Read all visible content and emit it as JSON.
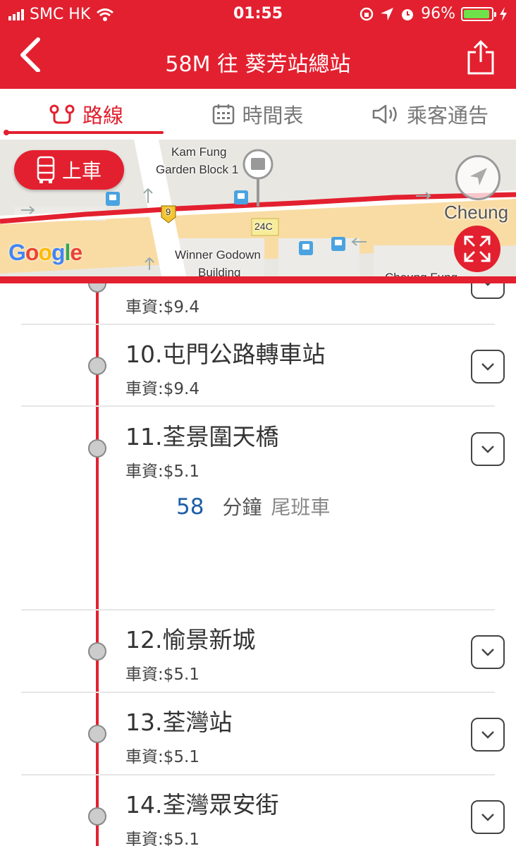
{
  "status_bar": {
    "carrier": "SMC HK",
    "time": "01:55",
    "battery_percent": "96%",
    "battery_level": 0.96
  },
  "header": {
    "title": "58M 往 葵芳站總站"
  },
  "tabs": [
    {
      "label": "路線",
      "active": true
    },
    {
      "label": "時間表",
      "active": false
    },
    {
      "label": "乘客通告",
      "active": false
    }
  ],
  "map": {
    "board_button_label": "上車",
    "google_logo": "Google",
    "labels": {
      "kam_fung_1": "Kam Fung",
      "kam_fung_2": "Garden Block 1",
      "winner_1": "Winner Godown",
      "winner_2": "Building",
      "cheung": "Cheung",
      "cheung_fung": "Cheung Fung",
      "route_9": "9",
      "route_24c": "24C"
    }
  },
  "stops": [
    {
      "name": "",
      "fare": "車資:$9.4"
    },
    {
      "name": "10.屯門公路轉車站",
      "fare": "車資:$9.4"
    },
    {
      "name": "11.荃景圍天橋",
      "fare": "車資:$5.1",
      "eta": {
        "minutes": "58",
        "unit": "分鐘",
        "note": "尾班車"
      }
    },
    {
      "name": "12.愉景新城",
      "fare": "車資:$5.1"
    },
    {
      "name": "13.荃灣站",
      "fare": "車資:$5.1"
    },
    {
      "name": "14.荃灣眾安街",
      "fare": "車資:$5.1"
    }
  ],
  "colors": {
    "brand_red": "#e3202f",
    "eta_blue": "#1f5ea8"
  }
}
